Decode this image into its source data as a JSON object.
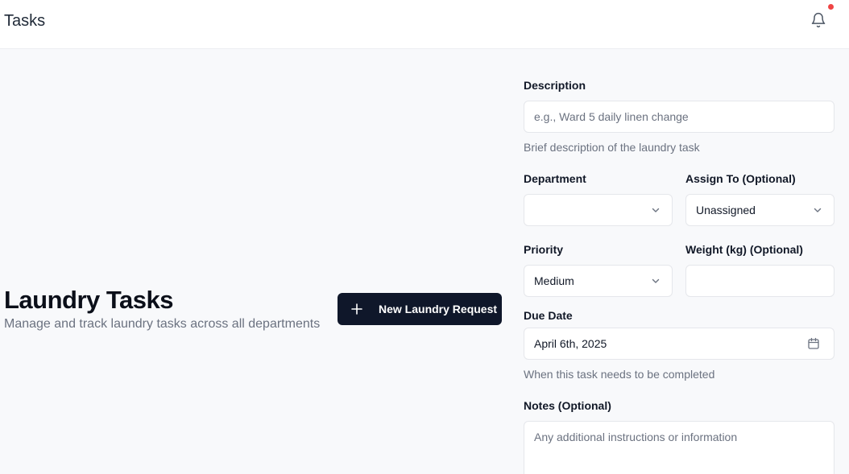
{
  "header": {
    "title": "Tasks",
    "notification_icon": "bell-icon",
    "notification_dot_color": "#ef4444"
  },
  "main": {
    "heading": "Laundry Tasks",
    "subheading": "Manage and track laundry tasks across all departments",
    "new_button_label": "New Laundry Request",
    "new_button_icon": "plus-icon"
  },
  "form": {
    "description": {
      "label": "Description",
      "placeholder": "e.g., Ward 5 daily linen change",
      "value": "",
      "helper": "Brief description of the laundry task"
    },
    "department": {
      "label": "Department",
      "selected": ""
    },
    "assign_to": {
      "label": "Assign To (Optional)",
      "selected": "Unassigned"
    },
    "priority": {
      "label": "Priority",
      "selected": "Medium"
    },
    "weight": {
      "label": "Weight (kg) (Optional)",
      "value": ""
    },
    "due_date": {
      "label": "Due Date",
      "value": "April 6th, 2025",
      "helper": "When this task needs to be completed",
      "icon": "calendar-icon"
    },
    "notes": {
      "label": "Notes (Optional)",
      "placeholder": "Any additional instructions or information",
      "value": ""
    }
  },
  "colors": {
    "primary_button": "#0f172a",
    "page_background": "#f8f9fb"
  }
}
